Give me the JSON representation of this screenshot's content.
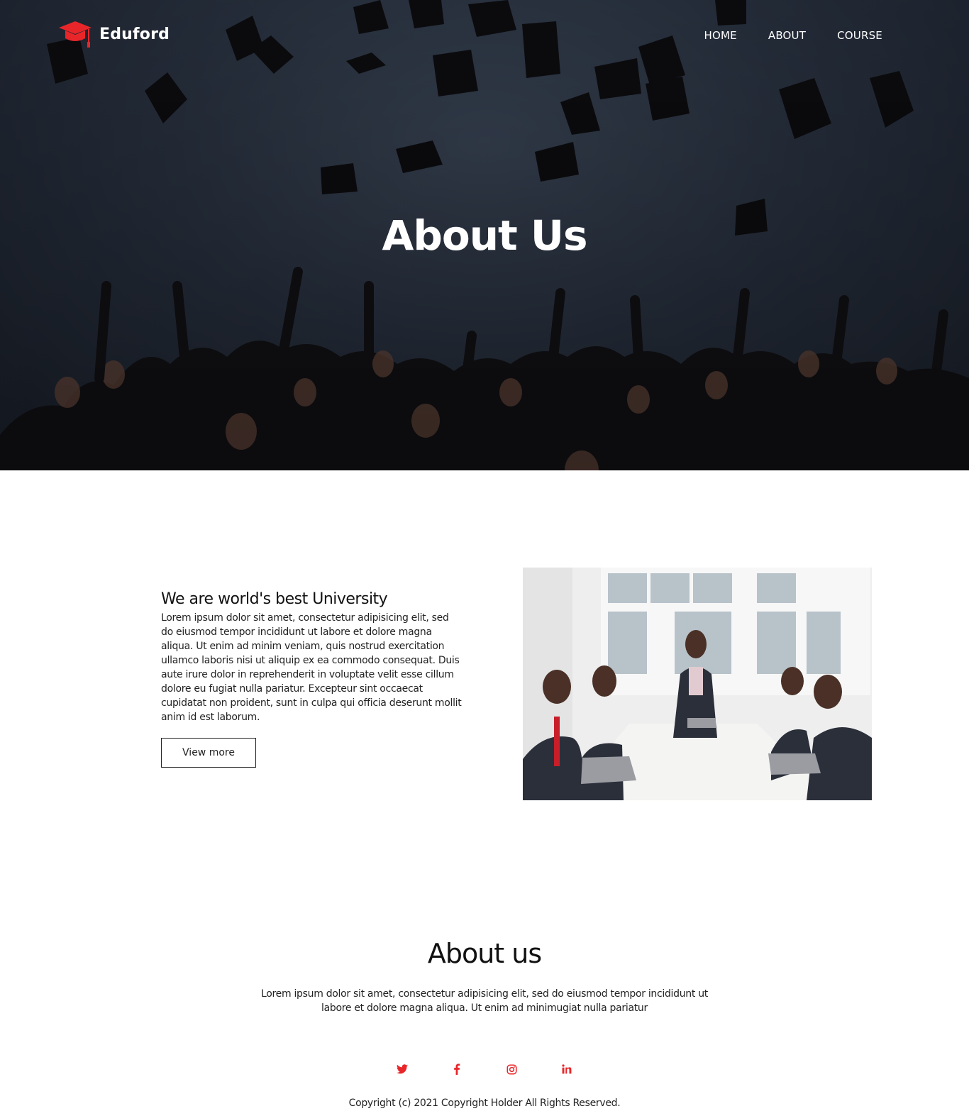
{
  "brand": {
    "name": "Eduford",
    "accent": "#e8262a"
  },
  "nav": {
    "items": [
      {
        "label": "HOME"
      },
      {
        "label": "ABOUT"
      },
      {
        "label": "COURSE"
      }
    ]
  },
  "hero": {
    "title": "About Us"
  },
  "about": {
    "heading": "We are world's best University",
    "body": "Lorem ipsum dolor sit amet, consectetur adipisicing elit, sed do eiusmod tempor incididunt ut labore et dolore magna aliqua. Ut enim ad minim veniam, quis nostrud exercitation ullamco laboris nisi ut aliquip ex ea commodo consequat. Duis aute irure dolor in reprehenderit in voluptate velit esse cillum dolore eu fugiat nulla pariatur. Excepteur sint occaecat cupidatat non proident, sunt in culpa qui officia deserunt mollit anim id est laborum.",
    "button_label": "View more"
  },
  "footer": {
    "title": "About us",
    "body": "Lorem ipsum dolor sit amet, consectetur adipisicing elit, sed do eiusmod tempor incididunt ut labore et dolore magna aliqua. Ut enim ad minimugiat nulla pariatur",
    "socials": [
      {
        "icon": "twitter-icon"
      },
      {
        "icon": "facebook-icon"
      },
      {
        "icon": "instagram-icon"
      },
      {
        "icon": "linkedin-icon"
      }
    ],
    "copyright": "Copyright (c) 2021 Copyright Holder All Rights Reserved."
  }
}
